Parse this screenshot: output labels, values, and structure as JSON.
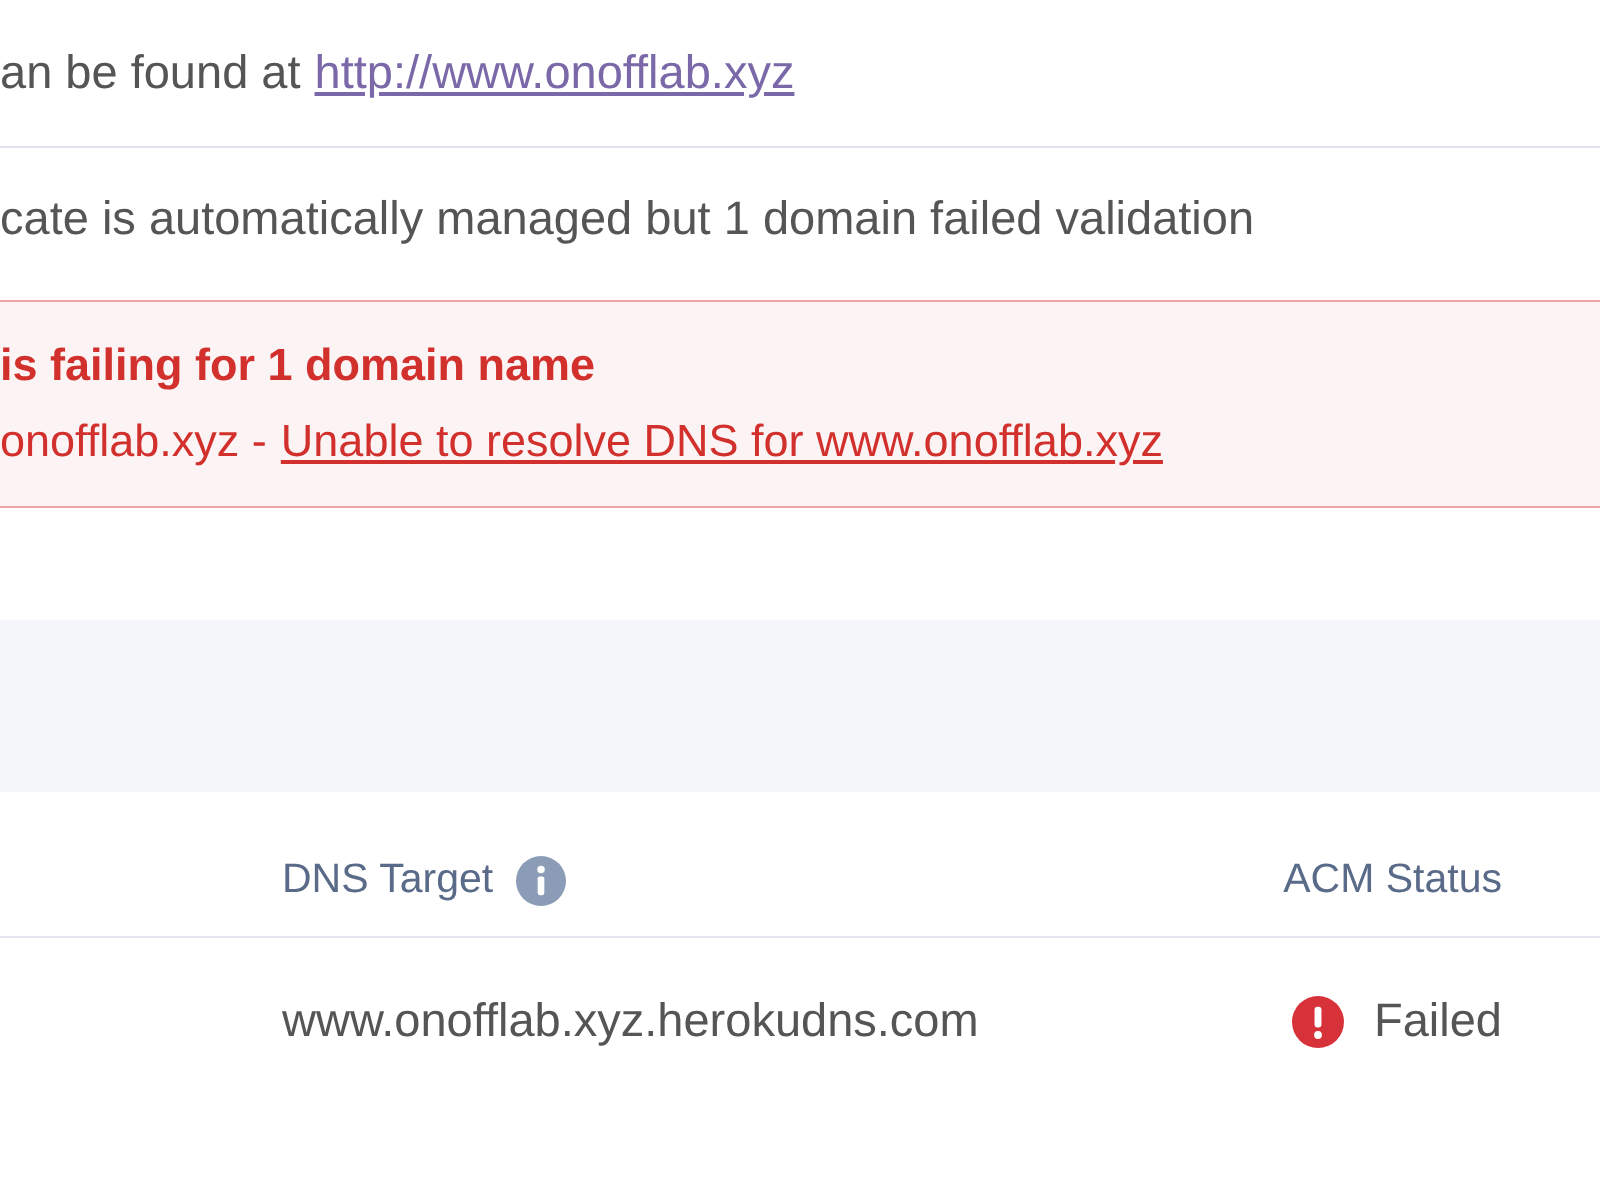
{
  "domain_info": {
    "text": "an be found at",
    "link": "http://www.onofflab.xyz"
  },
  "certificate_status": {
    "text": "cate is automatically managed but 1 domain failed validation"
  },
  "error_alert": {
    "title": "is failing for 1 domain name",
    "domain": "onofflab.xyz -",
    "link": "Unable to resolve DNS for www.onofflab.xyz"
  },
  "domains_table": {
    "columns": [
      {
        "label": "DNS Target",
        "info_icon": true
      },
      {
        "label": "ACM Status",
        "info_icon": false
      }
    ],
    "rows": [
      {
        "dns_target": "www.onofflab.xyz.herokudns.com",
        "acm_status": {
          "kind": "failed",
          "label": "Failed"
        }
      }
    ]
  }
}
